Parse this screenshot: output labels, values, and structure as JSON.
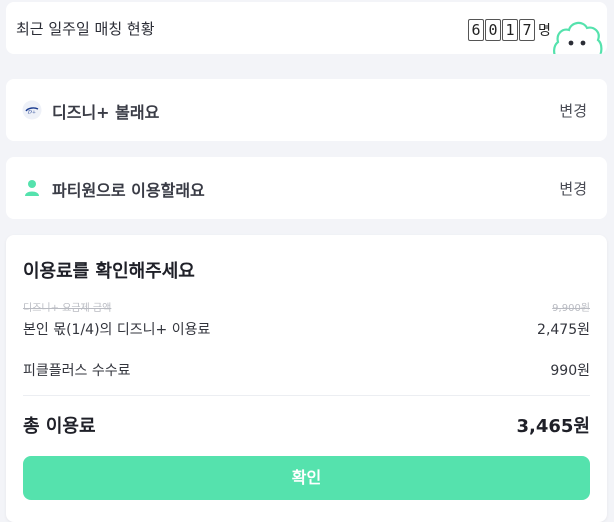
{
  "match": {
    "title": "최근 일주일 매칭 현황",
    "digits": [
      "6",
      "0",
      "1",
      "7"
    ],
    "unit": "명"
  },
  "service": {
    "label": "디즈니+ 볼래요",
    "change_label": "변경",
    "icon": "disney-plus-logo"
  },
  "party": {
    "label": "파티원으로 이용할래요",
    "change_label": "변경",
    "icon": "person-icon"
  },
  "fee": {
    "title": "이용료를 확인해주세요",
    "original_label": "디즈니+ 요금제 금액",
    "original_value": "9,900원",
    "own_label": "본인 몫(1/4)의 디즈니+ 이용료",
    "own_value": "2,475원",
    "commission_label": "피클플러스 수수료",
    "commission_value": "990원",
    "total_label": "총 이용료",
    "total_value": "3,465원",
    "confirm_label": "확인"
  },
  "colors": {
    "accent": "#55e2ad",
    "background": "#f3f4f8"
  }
}
